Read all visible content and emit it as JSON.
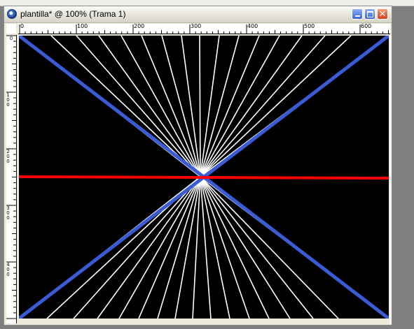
{
  "window": {
    "title": "plantilla* @ 100% (Trama 1)",
    "icon": "paintshop-app-icon",
    "buttons": {
      "minimize": "minimize-icon",
      "maximize": "maximize-icon",
      "close": "close-icon"
    }
  },
  "ruler_top": {
    "labels": [
      "0",
      "100",
      "200",
      "300",
      "400",
      "500",
      "600"
    ]
  },
  "ruler_left": {
    "labels": [
      "0",
      "100",
      "200",
      "300",
      "400"
    ]
  },
  "canvas": {
    "background": "#000000",
    "line_colors": {
      "white": "#ffffff",
      "blue": "#3a5bd6",
      "red": "#ff0000"
    }
  }
}
